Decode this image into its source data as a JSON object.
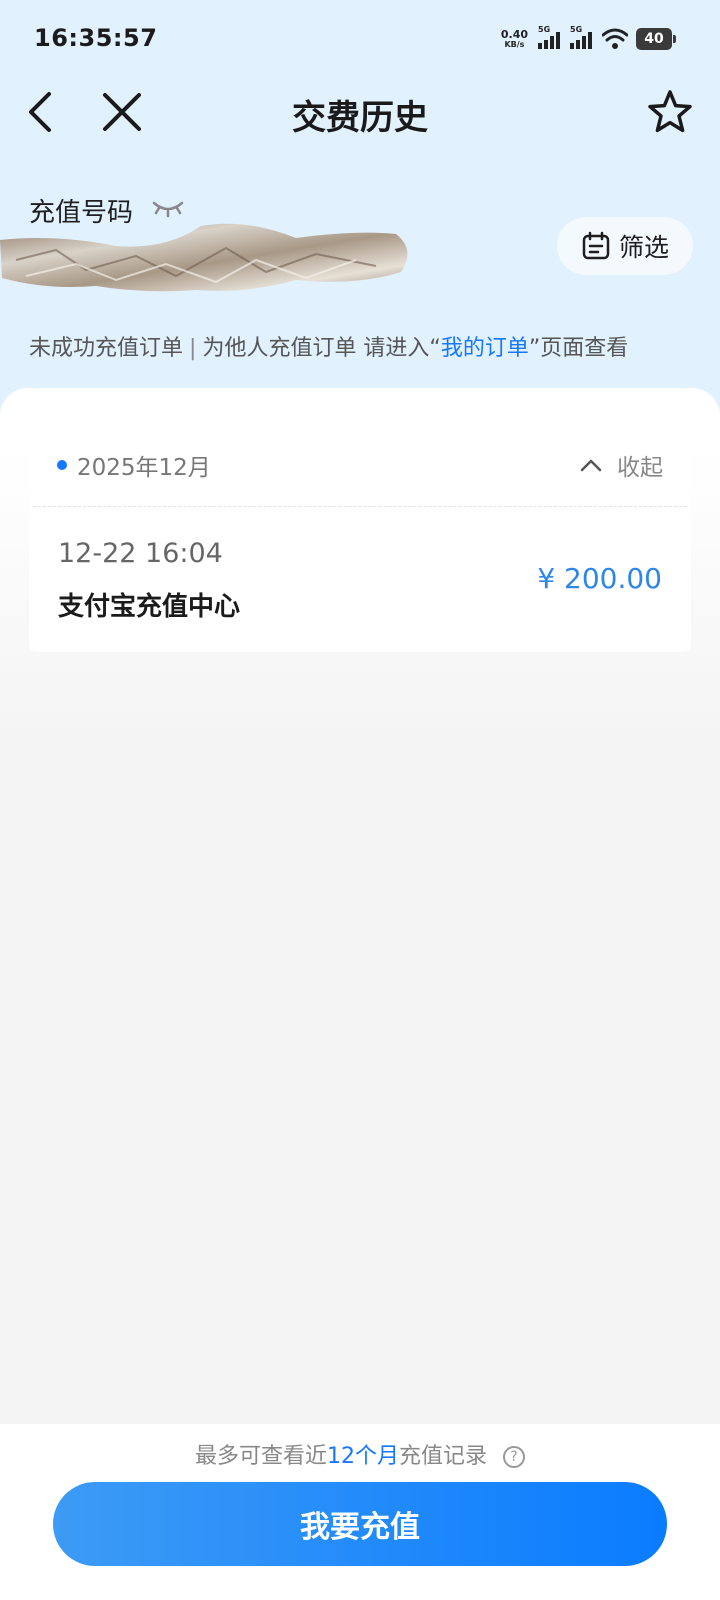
{
  "status_bar": {
    "time": "16:35:57",
    "net_speed_value": "0.40",
    "net_speed_unit": "KB/s",
    "sim1_label": "5G",
    "sim2_label": "5G",
    "battery_level": "40",
    "icons": [
      "signal-icon",
      "wifi-icon",
      "battery-icon"
    ]
  },
  "nav": {
    "title": "交费历史",
    "icons": [
      "back-icon",
      "close-icon",
      "star-icon"
    ]
  },
  "account": {
    "label": "充值号码",
    "eye_icon": "eye-closed-icon"
  },
  "filter": {
    "label": "筛选",
    "icon": "calendar-filter-icon"
  },
  "notice": {
    "part1": "未成功充值订单",
    "separator": "|",
    "part2": "为他人充值订单 请进入“",
    "link": "我的订单",
    "part3": "”页面查看"
  },
  "records": {
    "month": "2025年12月",
    "collapse_label": "收起",
    "items": [
      {
        "time": "12-22 16:04",
        "name": "支付宝充值中心",
        "amount": "¥ 200.00"
      }
    ]
  },
  "footer": {
    "note_prefix": "最多可查看近",
    "note_highlight": "12个月",
    "note_suffix": "充值记录",
    "help_icon": "?",
    "button_label": "我要充值"
  },
  "colors": {
    "accent": "#1677ff",
    "amount": "#2d87e9",
    "header_bg": "#e1f1fd",
    "page_bg": "#f4f4f4"
  }
}
